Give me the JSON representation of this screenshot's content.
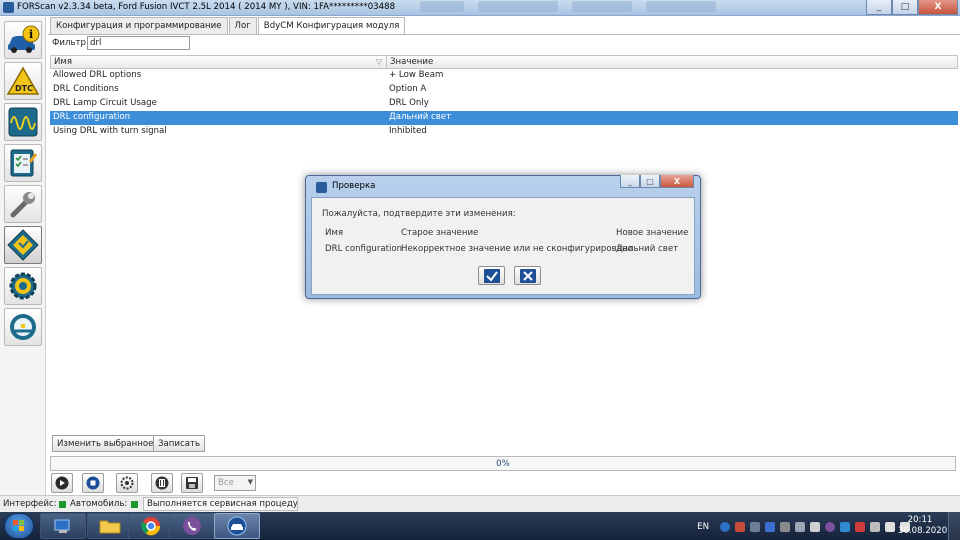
{
  "window": {
    "title": "FORScan v2.3.34 beta, Ford Fusion IVCT 2.5L 2014 ( 2014 MY ), VIN: 1FA*********03488",
    "controls": [
      "_",
      "□",
      "X"
    ]
  },
  "left_toolbar": [
    {
      "icon": "vehicle-info-icon"
    },
    {
      "icon": "dtc-icon",
      "label": "DTC"
    },
    {
      "icon": "oscilloscope-icon"
    },
    {
      "icon": "checklist-icon"
    },
    {
      "icon": "wrench-icon"
    },
    {
      "icon": "chip-icon"
    },
    {
      "icon": "gear-icon"
    },
    {
      "icon": "help-icon"
    }
  ],
  "tabs": [
    {
      "label": "Конфигурация и программирование",
      "active": false
    },
    {
      "label": "Лог",
      "active": false
    },
    {
      "label": "BdyCM Конфигурация модуля",
      "active": true
    }
  ],
  "filter": {
    "label": "Фильтр:",
    "value": "drl"
  },
  "table": {
    "columns": [
      "Имя",
      "Значение"
    ],
    "sort_indicator": "▽",
    "rows": [
      {
        "name": "Allowed DRL options",
        "value": "+ Low Beam",
        "selected": false
      },
      {
        "name": "DRL Conditions",
        "value": "Option A",
        "selected": false
      },
      {
        "name": "DRL Lamp Circuit Usage",
        "value": "DRL Only",
        "selected": false
      },
      {
        "name": "DRL configuration",
        "value": "Дальний свет",
        "selected": true
      },
      {
        "name": "Using DRL with turn signal",
        "value": "Inhibited",
        "selected": false
      }
    ]
  },
  "actions": {
    "change_label": "Изменить выбранное",
    "write_label": "Записать"
  },
  "progress": {
    "text": "0%",
    "fraction": 0
  },
  "controls": {
    "select_value": "Все",
    "buttons": [
      "play-icon",
      "stop-icon",
      "settings-icon",
      "delete-icon",
      "save-icon"
    ]
  },
  "status": {
    "interface_label": "Интерфейс:",
    "vehicle_label": "Автомобиль:",
    "message": "Выполняется сервисная процедура...",
    "led_color": "#1a9a2c"
  },
  "dialog": {
    "title": "Проверка",
    "prompt": "Пожалуйста, подтвердите эти изменения:",
    "headers": {
      "name": "Имя",
      "old": "Старое значение",
      "new": "Новое значение"
    },
    "row": {
      "name": "DRL configuration",
      "old": "Некорректное значение или не сконфигурировано",
      "new": "Дальний свет"
    },
    "confirm_icon": "check-icon",
    "cancel_icon": "cancel-icon"
  },
  "taskbar": {
    "apps": [
      "explorer-icon",
      "folder-icon",
      "chrome-icon",
      "viber-icon",
      "forscan-icon"
    ],
    "language": "EN",
    "time": "20:11",
    "date": "30.08.2020"
  },
  "colors": {
    "selection": "#3d8ed8",
    "accent_dialog": "#9dbbe0"
  }
}
